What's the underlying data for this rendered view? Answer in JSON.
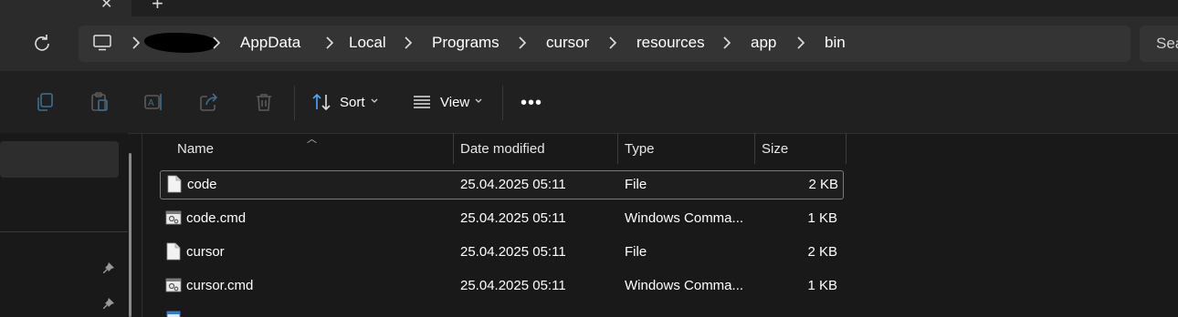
{
  "tabs": {
    "close_glyph": "✕",
    "new_glyph": "+"
  },
  "address": {
    "crumbs": [
      "AppData",
      "Local",
      "Programs",
      "cursor",
      "resources",
      "app",
      "bin"
    ]
  },
  "search": {
    "text": "Sea"
  },
  "toolbar": {
    "sort_label": "Sort",
    "view_label": "View",
    "more_glyph": "•••"
  },
  "columns": {
    "name": "Name",
    "date": "Date modified",
    "type": "Type",
    "size": "Size"
  },
  "files": [
    {
      "name": "code",
      "date": "25.04.2025 05:11",
      "type": "File",
      "size": "2 KB",
      "icon": "file-icon"
    },
    {
      "name": "code.cmd",
      "date": "25.04.2025 05:11",
      "type": "Windows Comma...",
      "size": "1 KB",
      "icon": "cmd-file-icon"
    },
    {
      "name": "cursor",
      "date": "25.04.2025 05:11",
      "type": "File",
      "size": "2 KB",
      "icon": "file-icon"
    },
    {
      "name": "cursor.cmd",
      "date": "25.04.2025 05:11",
      "type": "Windows Comma...",
      "size": "1 KB",
      "icon": "cmd-file-icon"
    }
  ],
  "colors": {
    "background": "#191919",
    "toolbar": "#202020",
    "accent": "#4aa8ff"
  }
}
